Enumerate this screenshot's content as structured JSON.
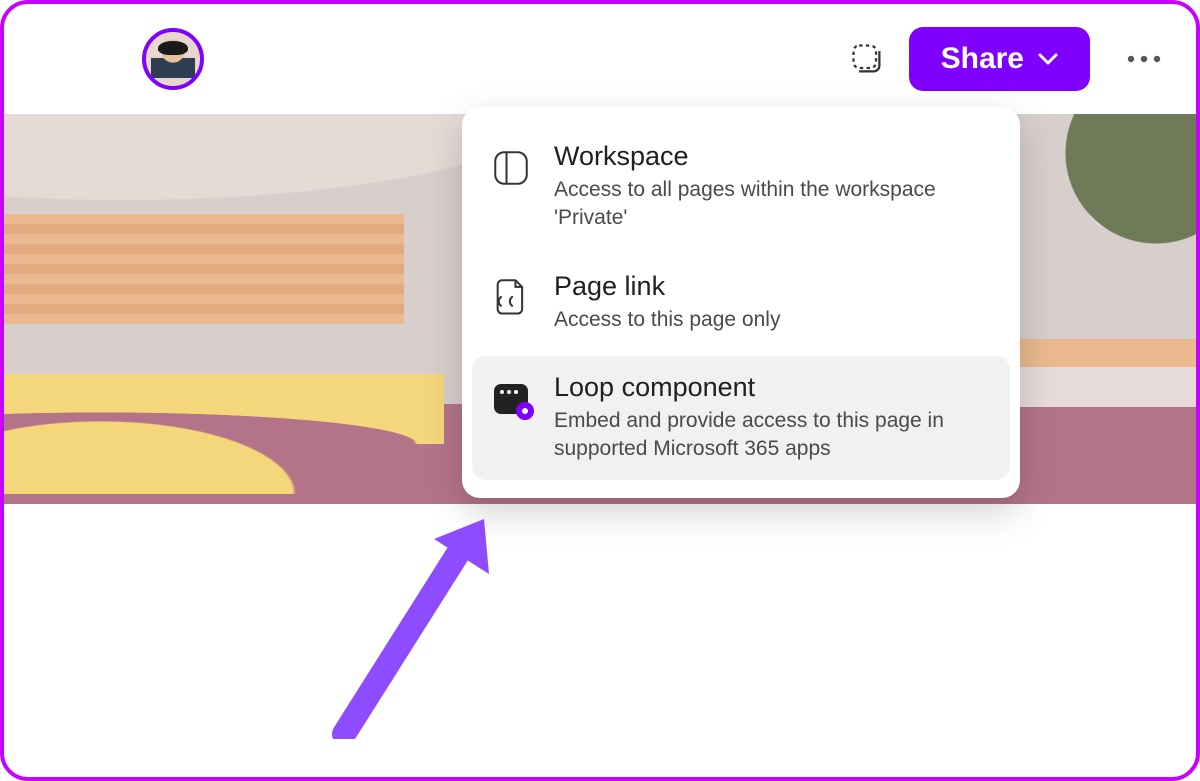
{
  "header": {
    "share_label": "Share"
  },
  "dropdown": {
    "items": [
      {
        "title": "Workspace",
        "desc": "Access to all pages within the workspace 'Private'"
      },
      {
        "title": "Page link",
        "desc": "Access to this page only"
      },
      {
        "title": "Loop component",
        "desc": "Embed and provide access to this page in supported Microsoft 365 apps"
      }
    ]
  }
}
